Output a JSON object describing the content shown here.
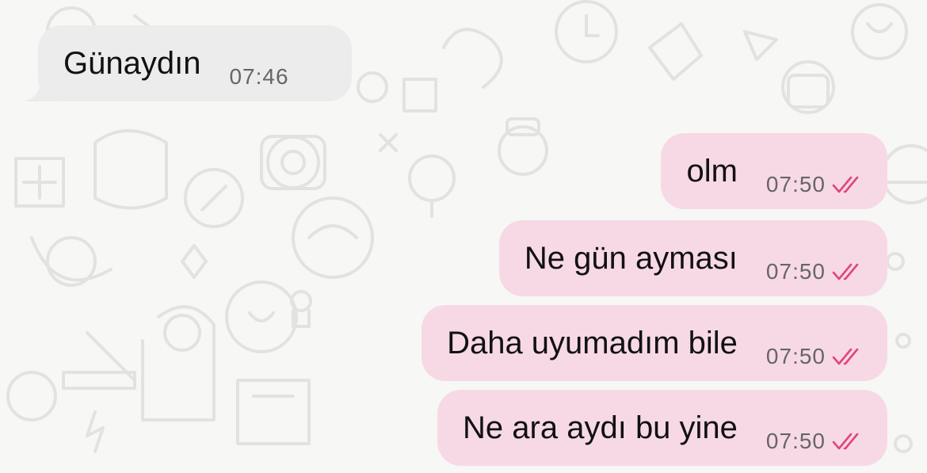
{
  "colors": {
    "incoming_bubble": "#ececec",
    "outgoing_bubble": "#f7d9e6",
    "read_ticks": "#e0457c",
    "timestamp": "#666666"
  },
  "incoming": [
    {
      "text": "Günaydın",
      "time": "07:46"
    }
  ],
  "outgoing": [
    {
      "text": "olm",
      "time": "07:50",
      "status_icon": "double-check-icon"
    },
    {
      "text": "Ne gün ayması",
      "time": "07:50",
      "status_icon": "double-check-icon"
    },
    {
      "text": "Daha uyumadım bile",
      "time": "07:50",
      "status_icon": "double-check-icon"
    },
    {
      "text": "Ne ara aydı bu yine",
      "time": "07:50",
      "status_icon": "double-check-icon"
    }
  ]
}
